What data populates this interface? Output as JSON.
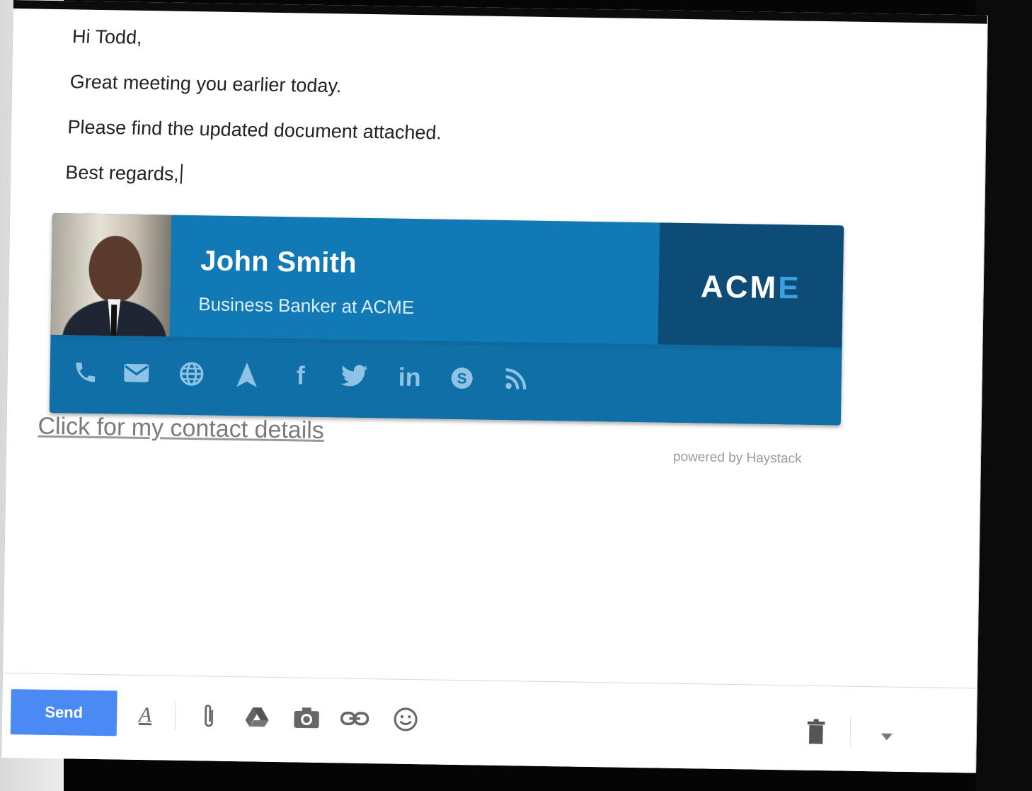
{
  "email": {
    "greeting": "Hi Todd,",
    "line1": "Great meeting you earlier today.",
    "line2": "Please find the updated document attached.",
    "closing": "Best regards,"
  },
  "signature": {
    "name": "John Smith",
    "role": "Business Banker at ACME",
    "logo_main": "ACM",
    "logo_accent": "E",
    "contact_link": "Click for my contact details",
    "powered_by": "powered by Haystack",
    "icons": [
      "phone-icon",
      "mail-icon",
      "globe-icon",
      "navigation-icon",
      "facebook-icon",
      "twitter-icon",
      "linkedin-icon",
      "skype-icon",
      "rss-icon"
    ],
    "colors": {
      "primary": "#1179b5",
      "logo_panel": "#0d4c77",
      "icon": "#8fc3e6"
    }
  },
  "toolbar": {
    "send_label": "Send",
    "icons": [
      "formatting-icon",
      "attach-icon",
      "drive-icon",
      "photo-icon",
      "link-icon",
      "emoji-icon",
      "trash-icon",
      "more-options-icon"
    ],
    "send_color": "#4a8af4"
  }
}
